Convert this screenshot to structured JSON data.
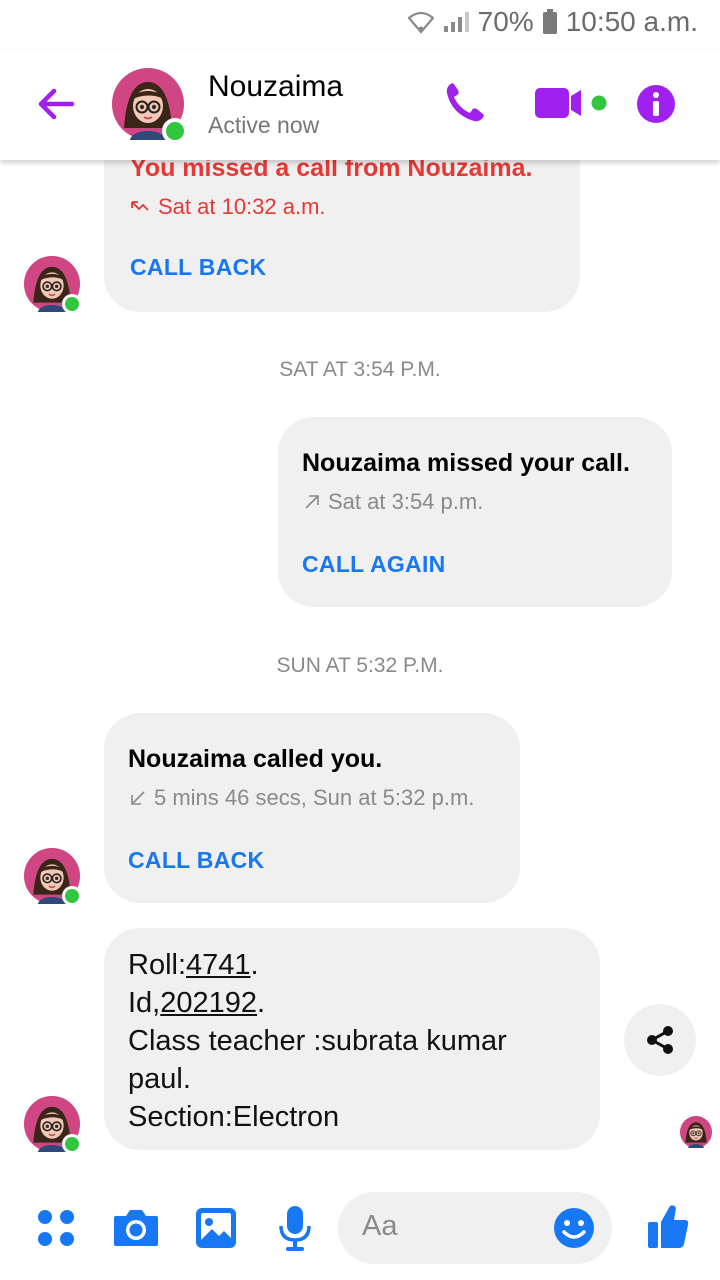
{
  "status_bar": {
    "battery": "70%",
    "time": "10:50 a.m."
  },
  "header": {
    "back_icon": "arrow-left-icon",
    "name": "Nouzaima",
    "status": "Active now",
    "accent_color": "#a020f0",
    "actions": [
      "phone-icon",
      "video-camera-icon",
      "info-icon"
    ]
  },
  "messages": [
    {
      "type": "call",
      "title": "You missed a call from Nouzaima.",
      "meta": "Sat at 10:32 a.m.",
      "action": "CALL BACK",
      "direction": "missed-incoming"
    },
    {
      "type": "timestamp",
      "text": "SAT AT 3:54 P.M."
    },
    {
      "type": "call",
      "title": "Nouzaima missed your call.",
      "meta": "Sat at 3:54 p.m.",
      "action": "CALL AGAIN",
      "direction": "outgoing"
    },
    {
      "type": "timestamp",
      "text": "SUN AT 5:32 P.M."
    },
    {
      "type": "call",
      "title": "Nouzaima called you.",
      "meta": "5 mins 46 secs, Sun at 5:32 p.m.",
      "action": "CALL BACK",
      "direction": "incoming"
    },
    {
      "type": "text",
      "lines": {
        "roll_label": "Roll:",
        "roll_value": "4741",
        "roll_end": ".",
        "id_label": "Id,",
        "id_value": "202192",
        "id_end": ".",
        "teacher": "Class teacher :subrata kumar paul.",
        "section": "Section:Electron"
      }
    }
  ],
  "composer": {
    "icons": [
      "menu-dots-icon",
      "camera-icon",
      "image-icon",
      "microphone-icon"
    ],
    "placeholder": "Aa",
    "emoji_icon": "smiley-icon",
    "send_icon": "thumbs-up-icon",
    "accent_color": "#1877f2"
  },
  "colors": {
    "online": "#31c63d",
    "missed": "#e53935",
    "link": "#1877f2",
    "bubble": "#f0f0f0"
  }
}
